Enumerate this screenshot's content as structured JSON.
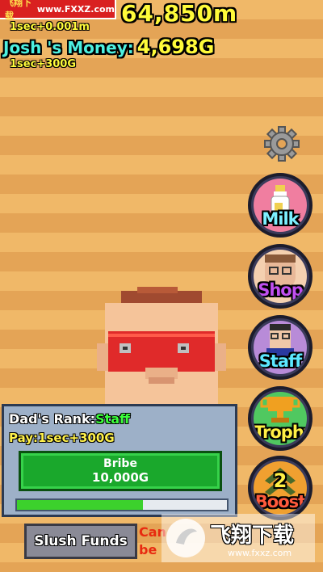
{
  "watermark": {
    "site_cn": "飞翔下载",
    "site_url": "www.FXXZ.com",
    "brand_cn": "飞翔下载",
    "brand_url": "www.fxxz.com"
  },
  "stats": {
    "distance": "64,850m",
    "distance_rate": "1sec+0.001m",
    "money_label": "Josh 's Money:",
    "money_value": "4,698G",
    "money_rate": "1sec+300G"
  },
  "side_buttons": [
    {
      "label": "Milk",
      "color": "#7cf0ff"
    },
    {
      "label": "Shop",
      "color": "#c04ff0"
    },
    {
      "label": "Staff",
      "color": "#5be8ff"
    },
    {
      "label": "Trophy",
      "color": "#ffef45"
    },
    {
      "label": "Boost",
      "color": "#ff5a3c",
      "badge": "2"
    }
  ],
  "panel": {
    "rank_label": "Dad's Rank:",
    "rank_value": "Staff",
    "pay": "Pay:1sec+300G",
    "bribe_label": "Bribe",
    "bribe_cost": "10,000G",
    "progress": 0.6
  },
  "slush": {
    "label": "Slush Funds",
    "note_line1": "Can",
    "note_line2": "be"
  },
  "icons": [
    "gear-icon",
    "milk-bottle-icon",
    "shop-icon",
    "staff-icon",
    "trophy-icon",
    "boost-icon"
  ]
}
